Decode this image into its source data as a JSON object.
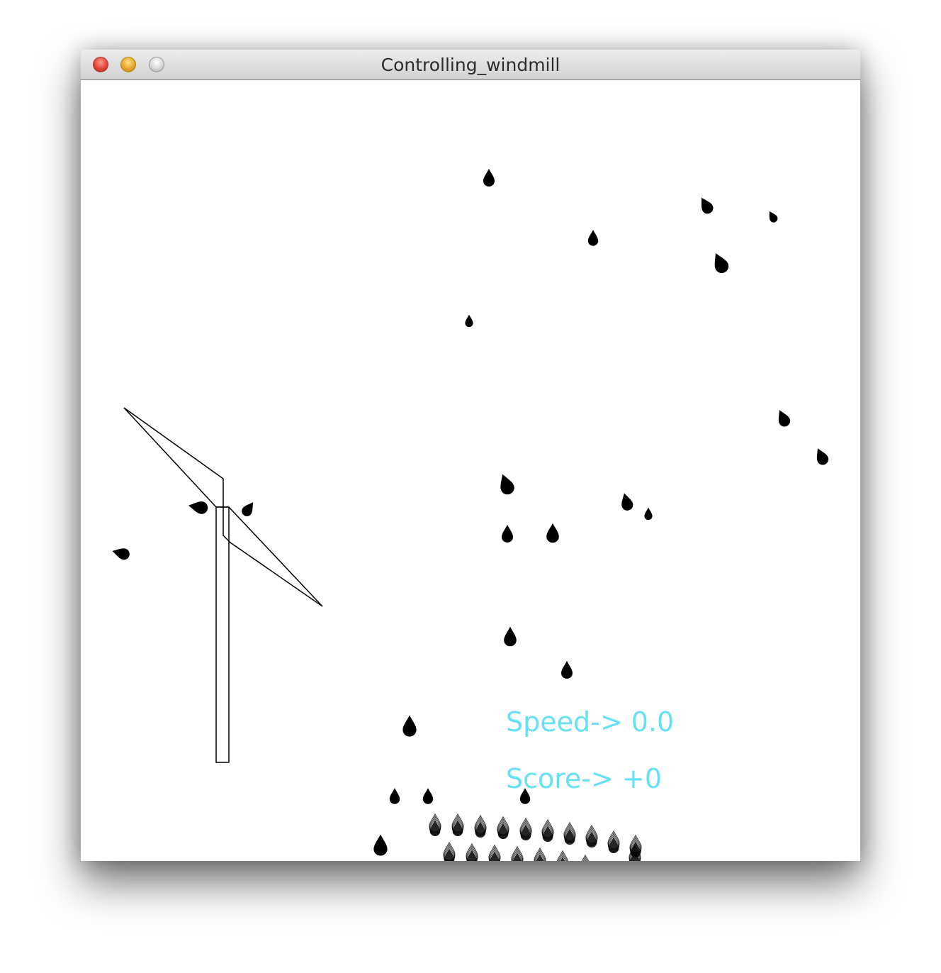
{
  "window": {
    "title": "Controlling_windmill",
    "controls": {
      "close": "close-icon",
      "minimize": "minimize-icon",
      "zoom": "zoom-icon"
    }
  },
  "hud": {
    "speed_label": "Speed-> 0.0",
    "score_label": "Score-> +0",
    "text_color": "#66e0f2"
  },
  "scene": {
    "ink_color": "#000000",
    "background_color": "#ffffff"
  }
}
